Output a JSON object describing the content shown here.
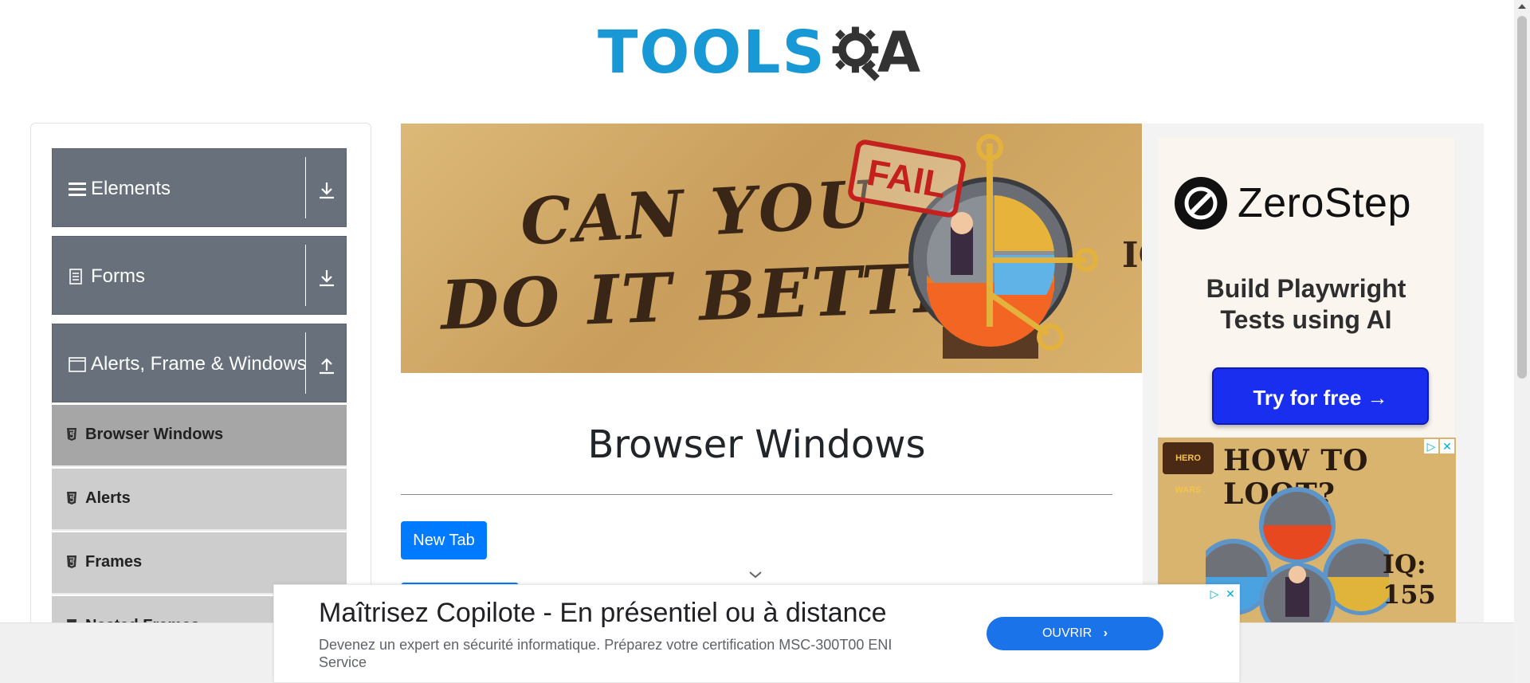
{
  "header": {
    "logo_text": "TOOLS",
    "logo_suffix": "A"
  },
  "sidebar": {
    "groups": [
      {
        "label": "Elements",
        "icon": "hamburger-icon",
        "expanded": false
      },
      {
        "label": "Forms",
        "icon": "document-icon",
        "expanded": false
      },
      {
        "label": "Alerts, Frame & Windows",
        "icon": "window-icon",
        "expanded": true
      }
    ],
    "items": [
      {
        "label": "Browser Windows",
        "active": true
      },
      {
        "label": "Alerts",
        "active": false
      },
      {
        "label": "Frames",
        "active": false
      },
      {
        "label": "Nested Frames",
        "active": false
      }
    ]
  },
  "banner_ad": {
    "line1": "CAN YOU",
    "line2": "DO IT BETTER?",
    "badge": "FAIL",
    "corner_text": "IC"
  },
  "main": {
    "page_title": "Browser Windows",
    "new_tab_button": "New Tab"
  },
  "side_ad": {
    "brand": "ZeroStep",
    "tagline_line1": "Build Playwright",
    "tagline_line2": "Tests using AI",
    "cta": "Try for free →"
  },
  "side_ad2": {
    "title": "HOW TO LOOT?",
    "iq": "IQ: 155",
    "badge": "HERO WARS"
  },
  "bottom_ad": {
    "headline": "Maîtrisez Copilote - En présentiel ou à distance",
    "description": "Devenez un expert en sécurité informatique. Préparez votre certification MSC-300T00 ENI Service",
    "cta": "OUVRIR"
  },
  "colors": {
    "brand_blue": "#1998d6",
    "sidebar_group": "#68717b",
    "sidebar_item": "#cdcdcd",
    "sidebar_item_active": "#a6a6a6",
    "primary_button": "#007bff",
    "zerostep_button": "#1a2ef0"
  }
}
